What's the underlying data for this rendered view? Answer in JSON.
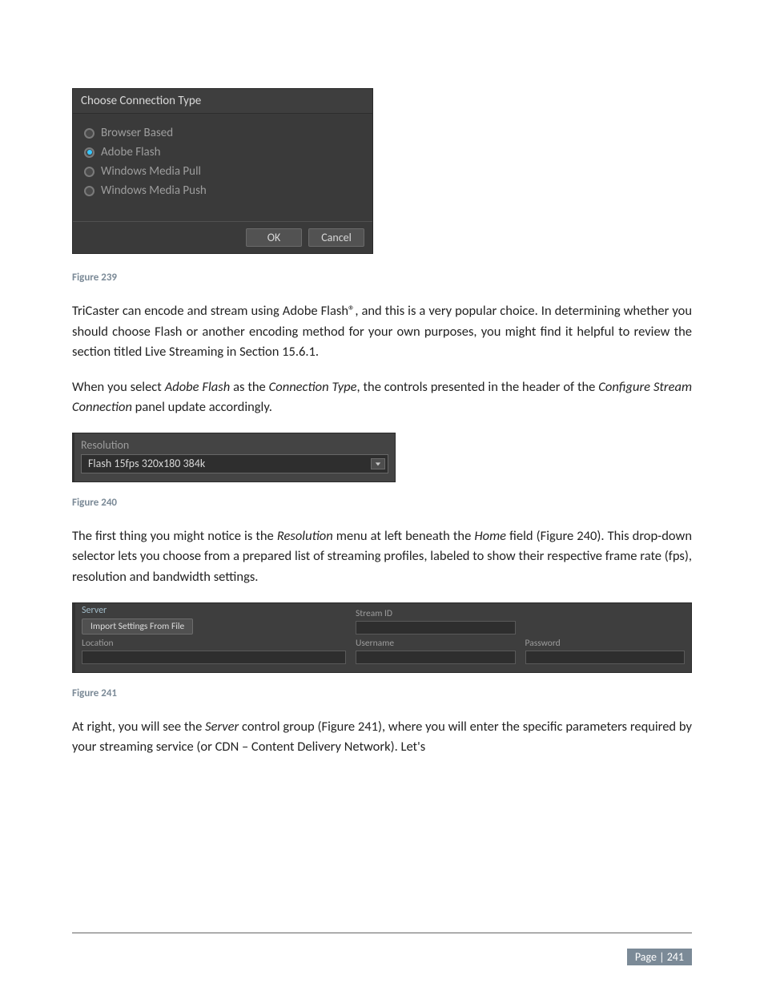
{
  "dialog": {
    "title": "Choose Connection Type",
    "options": [
      {
        "label": "Browser Based",
        "selected": false
      },
      {
        "label": "Adobe Flash",
        "selected": true
      },
      {
        "label": "Windows Media Pull",
        "selected": false
      },
      {
        "label": "Windows Media Push",
        "selected": false
      }
    ],
    "ok": "OK",
    "cancel": "Cancel"
  },
  "captions": {
    "fig239": "Figure 239",
    "fig240": "Figure 240",
    "fig241": "Figure 241"
  },
  "paragraphs": {
    "p1_a": "TriCaster can encode and stream using Adobe Flash®, and this is a very popular choice.  In determining whether you should choose Flash or another encoding method for your own purposes, you might find it helpful to review the section titled Live Streaming in Section 15.6.1.",
    "p2_a": "When you select ",
    "p2_b": "Adobe Flash",
    "p2_c": " as the ",
    "p2_d": "Connection Type",
    "p2_e": ", the controls presented in the header of the ",
    "p2_f": "Configure Stream Connection",
    "p2_g": " panel update accordingly.",
    "p3_a": "The first thing you might notice is the ",
    "p3_b": "Resolution",
    "p3_c": " menu at left beneath the ",
    "p3_d": "Home",
    "p3_e": " field (Figure 240).  This drop-down selector lets you choose from a prepared list of streaming profiles, labeled to show their respective frame rate (fps), resolution and bandwidth settings.",
    "p4_a": "At right, you will see the ",
    "p4_b": "Server",
    "p4_c": " control group (Figure 241), where you will enter the specific parameters required by your streaming service (or CDN – Content Delivery Network).  Let's"
  },
  "resolution": {
    "label": "Resolution",
    "value": "Flash 15fps 320x180 384k"
  },
  "server": {
    "legend": "Server",
    "import_btn": "Import Settings From File",
    "stream_id": "Stream ID",
    "location": "Location",
    "username": "Username",
    "password": "Password"
  },
  "footer": {
    "page": "Page | 241"
  }
}
